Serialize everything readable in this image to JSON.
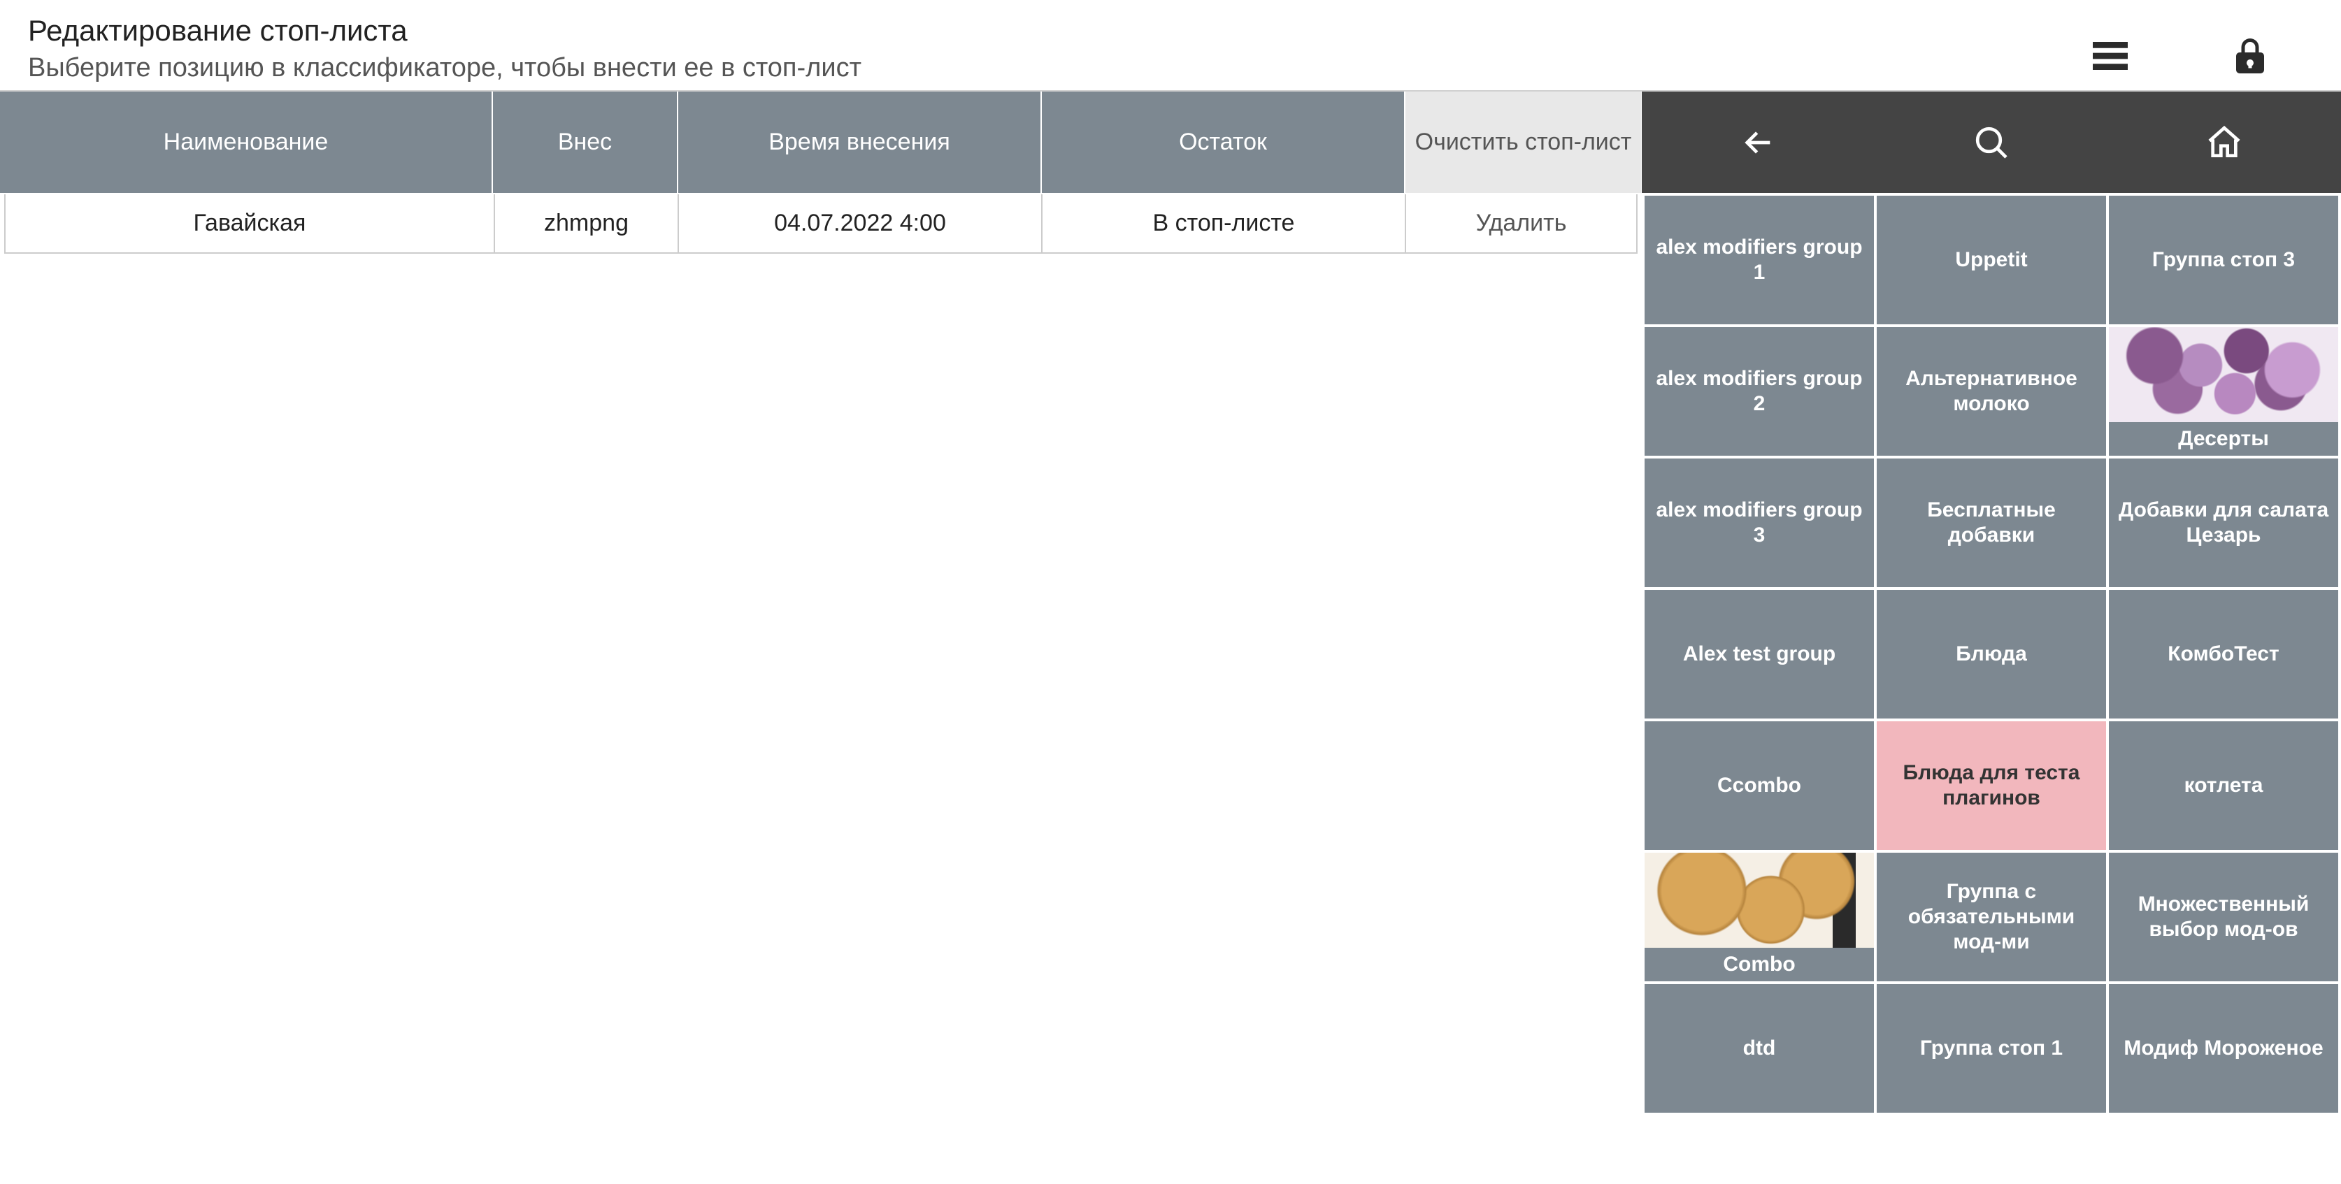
{
  "header": {
    "title": "Редактирование стоп-листа",
    "subtitle": "Выберите позицию в классификаторе, чтобы внести ее в стоп-лист"
  },
  "table": {
    "columns": {
      "name": "Наименование",
      "user": "Внес",
      "time": "Время внесения",
      "remain": "Остаток",
      "clear": "Очистить стоп-лист"
    },
    "rows": [
      {
        "name": "Гавайская",
        "user": "zhmpng",
        "time": "04.07.2022 4:00",
        "remain": "В стоп-листе",
        "action": "Удалить"
      }
    ]
  },
  "categories": [
    {
      "label": "alex modifiers group 1",
      "style": "default"
    },
    {
      "label": "Uppetit",
      "style": "default"
    },
    {
      "label": "Группа стоп 3",
      "style": "default"
    },
    {
      "label": "alex modifiers group 2",
      "style": "default"
    },
    {
      "label": "Альтернативное молоко",
      "style": "default"
    },
    {
      "label": "Десерты",
      "style": "image-dessert"
    },
    {
      "label": "alex modifiers group 3",
      "style": "default"
    },
    {
      "label": "Бесплатные добавки",
      "style": "default"
    },
    {
      "label": "Добавки для салата Цезарь",
      "style": "default"
    },
    {
      "label": "Alex test group",
      "style": "default"
    },
    {
      "label": "Блюда",
      "style": "default"
    },
    {
      "label": "КомбоТест",
      "style": "default"
    },
    {
      "label": "Ccombo",
      "style": "default"
    },
    {
      "label": "Блюда для теста плагинов",
      "style": "pink"
    },
    {
      "label": "котлета",
      "style": "default"
    },
    {
      "label": "Combo",
      "style": "image-pizza"
    },
    {
      "label": "Группа с обязательными мод-ми",
      "style": "default"
    },
    {
      "label": "Множественный выбор мод-ов",
      "style": "default"
    },
    {
      "label": "dtd",
      "style": "default"
    },
    {
      "label": "Группа стоп 1",
      "style": "default"
    },
    {
      "label": "Модиф Мороженое",
      "style": "default"
    }
  ]
}
